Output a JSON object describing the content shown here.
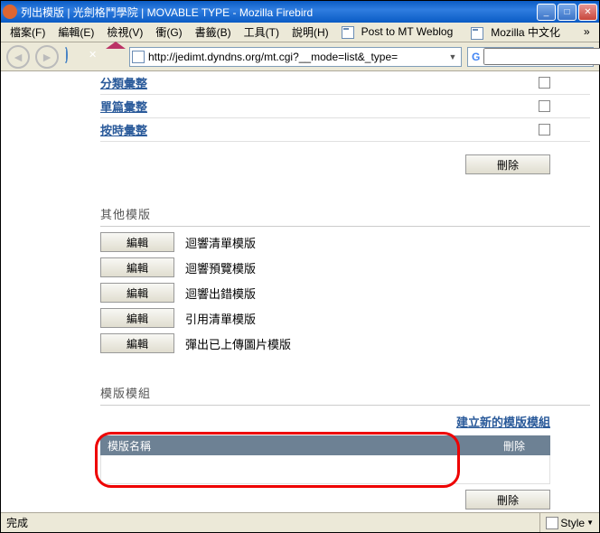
{
  "window": {
    "title": "列出模版 | 光劍格鬥學院 | MOVABLE TYPE - Mozilla Firebird"
  },
  "menu": {
    "file": "檔案(F)",
    "edit": "編輯(E)",
    "view": "檢視(V)",
    "go": "衝(G)",
    "bookmarks": "書籤(B)",
    "tools": "工具(T)",
    "help": "說明(H)",
    "bm1": "Post to MT Weblog",
    "bm2": "Mozilla 中文化"
  },
  "url": "http://jedimt.dyndns.org/mt.cgi?__mode=list&_type=",
  "archives": {
    "cat": "分類彙整",
    "ind": "單篇彙整",
    "date": "按時彙整"
  },
  "buttons": {
    "delete": "刪除",
    "edit": "編輯"
  },
  "sections": {
    "other": "其他模版",
    "modules": "模版模組"
  },
  "templates": {
    "t1": "迴響清單模版",
    "t2": "迴響預覽模版",
    "t3": "迴響出錯模版",
    "t4": "引用清單模版",
    "t5": "彈出已上傳圖片模版"
  },
  "modlink": "建立新的模版模組",
  "table": {
    "name": "模版名稱",
    "del": "刪除"
  },
  "status": {
    "done": "完成",
    "style": "Style"
  }
}
